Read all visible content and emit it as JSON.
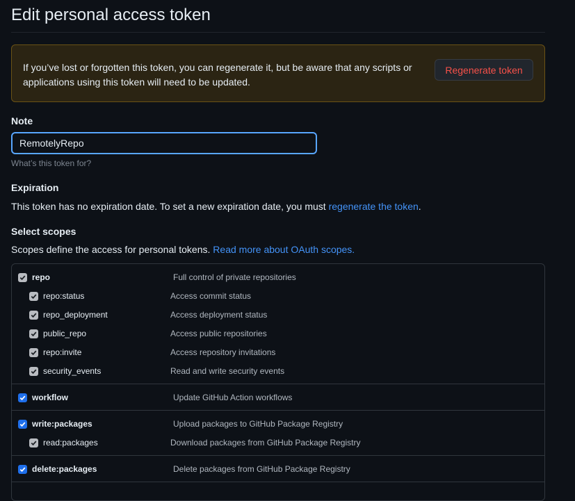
{
  "page": {
    "title": "Edit personal access token"
  },
  "warning": {
    "text": "If you’ve lost or forgotten this token, you can regenerate it, but be aware that any scripts or applications using this token will need to be updated.",
    "button_label": "Regenerate token"
  },
  "note": {
    "label": "Note",
    "value": "RemotelyRepo",
    "hint": "What’s this token for?"
  },
  "expiration": {
    "label": "Expiration",
    "text": "This token has no expiration date. To set a new expiration date, you must",
    "link": "regenerate the token",
    "suffix": "."
  },
  "scopes": {
    "label": "Select scopes",
    "text": "Scopes define the access for personal tokens.",
    "link": "Read more about OAuth scopes.",
    "repo": {
      "name": "repo",
      "desc": "Full control of private repositories",
      "children": [
        {
          "name": "repo:status",
          "desc": "Access commit status"
        },
        {
          "name": "repo_deployment",
          "desc": "Access deployment status"
        },
        {
          "name": "public_repo",
          "desc": "Access public repositories"
        },
        {
          "name": "repo:invite",
          "desc": "Access repository invitations"
        },
        {
          "name": "security_events",
          "desc": "Read and write security events"
        }
      ]
    },
    "workflow": {
      "name": "workflow",
      "desc": "Update GitHub Action workflows"
    },
    "write_packages": {
      "name": "write:packages",
      "desc": "Upload packages to GitHub Package Registry",
      "children": [
        {
          "name": "read:packages",
          "desc": "Download packages from GitHub Package Registry"
        }
      ]
    },
    "delete_packages": {
      "name": "delete:packages",
      "desc": "Delete packages from GitHub Package Registry"
    }
  },
  "colors": {
    "background": "#0d1117",
    "link": "#4493f8",
    "danger": "#f85149",
    "checkbox_checked": "#1f6feb",
    "checkbox_disabled": "#b9bcc1",
    "warning_bg": "#2b2413",
    "focus_border": "#58a6ff"
  }
}
